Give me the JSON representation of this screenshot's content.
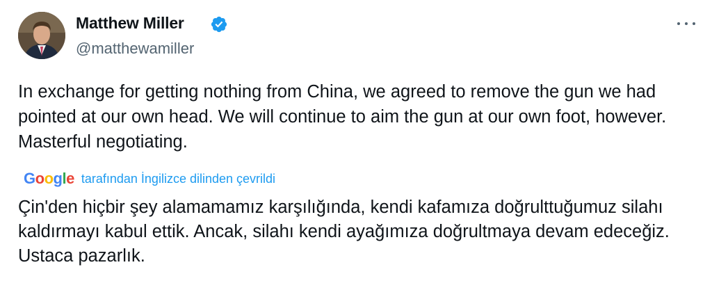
{
  "author": {
    "name": "Matthew Miller",
    "handle": "@matthewamiller"
  },
  "icons": {
    "verified": "verified-badge-icon",
    "more": "more-options-icon",
    "avatar": "profile-avatar"
  },
  "tweet": {
    "text": "In exchange for getting nothing from China, we agreed to remove the gun we had pointed at our own head. We will continue to aim the gun at our own foot, however. Masterful negotiating."
  },
  "translation": {
    "provider": "Google",
    "credit": "tarafından İngilizce dilinden çevrildi",
    "text": "Çin'den hiçbir şey alamamamız karşılığında, kendi kafamıza doğrulttuğumuz silahı kaldırmayı kabul ettik. Ancak, silahı kendi ayağımıza doğrultmaya devam edeceğiz. Ustaca pazarlık."
  },
  "colors": {
    "text": "#0f1419",
    "secondary": "#536471",
    "accent": "#1d9bf0",
    "verified": "#1d9bf0"
  }
}
